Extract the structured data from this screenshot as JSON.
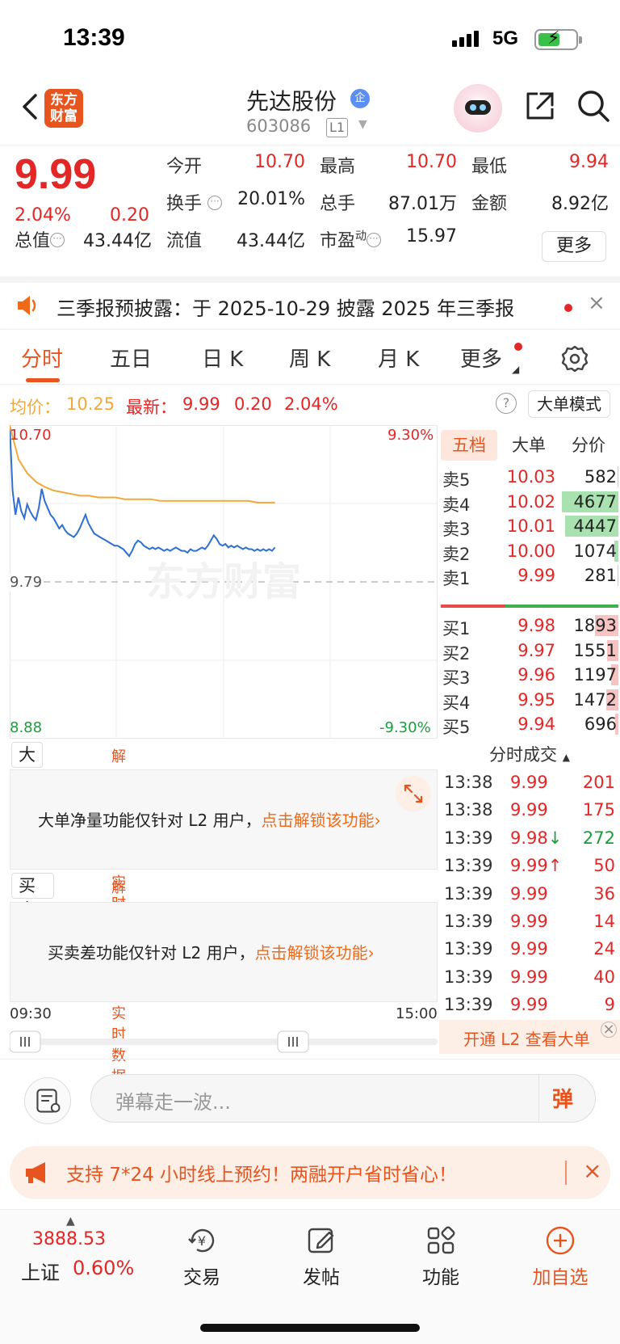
{
  "status_bar": {
    "time": "13:39",
    "network": "5G"
  },
  "header": {
    "logo_line1": "东方",
    "logo_line2": "财富",
    "stock_name": "先达股份",
    "badge": "企",
    "stock_code": "603086",
    "level": "L1"
  },
  "quote": {
    "price": "9.99",
    "change_pct": "2.04%",
    "change": "0.20",
    "open_label": "今开",
    "open": "10.70",
    "high_label": "最高",
    "high": "10.70",
    "low_label": "最低",
    "low": "9.94",
    "turnover_label": "换手",
    "turnover": "20.01%",
    "volume_label": "总手",
    "volume": "87.01万",
    "amount_label": "金额",
    "amount": "8.92亿",
    "total_cap_label": "总值",
    "total_cap": "43.44亿",
    "float_cap_label": "流值",
    "float_cap": "43.44亿",
    "pe_label": "市盈",
    "pe_sup": "动",
    "pe": "15.97",
    "more_label": "更多"
  },
  "notice": {
    "text": "三季报预披露：于 2025-10-29 披露 2025 年三季报",
    "close": "×"
  },
  "tabs": [
    "分时",
    "五日",
    "日 K",
    "周 K",
    "月 K",
    "更多"
  ],
  "info_line": {
    "avg_label": "均价：",
    "avg": "10.25",
    "latest_label": "最新：",
    "latest": "9.99",
    "change": "0.20",
    "change_pct": "2.04%",
    "help": "?",
    "mode_button": "大单模式"
  },
  "chart_data": {
    "type": "line",
    "title": "",
    "y_top": "10.70",
    "y_mid": "9.79",
    "y_bottom": "8.88",
    "pct_top": "9.30%",
    "pct_bottom": "-9.30%",
    "ylim": [
      8.88,
      10.7
    ],
    "prev_close": 9.79,
    "watermark": "东方财富",
    "series": [
      {
        "name": "price",
        "color": "#2e6fd1",
        "values": [
          10.7,
          10.32,
          10.18,
          10.28,
          10.2,
          10.16,
          10.24,
          10.2,
          10.17,
          10.15,
          10.22,
          10.33,
          10.26,
          10.22,
          10.18,
          10.16,
          10.13,
          10.1,
          10.12,
          10.09,
          10.07,
          10.06,
          10.05,
          10.07,
          10.1,
          10.14,
          10.18,
          10.13,
          10.1,
          10.07,
          10.06,
          10.05,
          10.04,
          10.03,
          10.02,
          10.01,
          10.0,
          10.0,
          9.99,
          9.98,
          9.96,
          9.94,
          9.97,
          10.01,
          10.03,
          10.02,
          10.0,
          9.99,
          9.98,
          9.99,
          9.98,
          9.99,
          9.98,
          9.97,
          9.98,
          9.97,
          9.98,
          9.99,
          9.98,
          9.97,
          9.97,
          9.96,
          9.98,
          9.97,
          9.97,
          9.98,
          9.99,
          9.98,
          10.0,
          10.03,
          10.06,
          10.04,
          10.01,
          10.0,
          10.01,
          9.99,
          10.0,
          9.99,
          10.0,
          9.99,
          9.98,
          9.99,
          9.98,
          9.98,
          9.97,
          9.98,
          9.97,
          9.98,
          9.97,
          9.98,
          9.97,
          9.99
        ]
      },
      {
        "name": "avg",
        "color": "#f2a93b",
        "values": [
          10.7,
          10.5,
          10.42,
          10.37,
          10.34,
          10.32,
          10.31,
          10.3,
          10.29,
          10.29,
          10.28,
          10.28,
          10.28,
          10.27,
          10.27,
          10.27,
          10.27,
          10.26,
          10.26,
          10.26,
          10.26,
          10.26,
          10.26,
          10.26,
          10.26,
          10.26,
          10.26,
          10.26,
          10.25,
          10.25,
          10.25
        ]
      }
    ],
    "total_points": 242
  },
  "order_book": {
    "tabs": [
      "五档",
      "大单",
      "分价"
    ],
    "asks": [
      {
        "label": "卖5",
        "price": "10.03",
        "vol": "582",
        "ratio": 0.02
      },
      {
        "label": "卖4",
        "price": "10.02",
        "vol": "4677",
        "ratio": 0.97
      },
      {
        "label": "卖3",
        "price": "10.01",
        "vol": "4447",
        "ratio": 0.92
      },
      {
        "label": "卖2",
        "price": "10.00",
        "vol": "1074",
        "ratio": 0.07
      },
      {
        "label": "卖1",
        "price": "9.99",
        "vol": "281",
        "ratio": 0.02
      }
    ],
    "bids": [
      {
        "label": "买1",
        "price": "9.98",
        "vol": "1893",
        "ratio": 0.4
      },
      {
        "label": "买2",
        "price": "9.97",
        "vol": "1551",
        "ratio": 0.2
      },
      {
        "label": "买3",
        "price": "9.96",
        "vol": "1197",
        "ratio": 0.12
      },
      {
        "label": "买4",
        "price": "9.95",
        "vol": "1472",
        "ratio": 0.21
      },
      {
        "label": "买5",
        "price": "9.94",
        "vol": "696",
        "ratio": 0.05
      }
    ]
  },
  "ticks": {
    "title": "分时成交",
    "rows": [
      {
        "time": "13:38",
        "price": "9.99",
        "vol": "201",
        "dir": "",
        "vcolor": "red"
      },
      {
        "time": "13:38",
        "price": "9.99",
        "vol": "175",
        "dir": "",
        "vcolor": "red"
      },
      {
        "time": "13:39",
        "price": "9.98",
        "vol": "272",
        "dir": "↓",
        "vcolor": "green"
      },
      {
        "time": "13:39",
        "price": "9.99",
        "vol": "50",
        "dir": "↑",
        "vcolor": "red"
      },
      {
        "time": "13:39",
        "price": "9.99",
        "vol": "36",
        "dir": "",
        "vcolor": "red"
      },
      {
        "time": "13:39",
        "price": "9.99",
        "vol": "14",
        "dir": "",
        "vcolor": "red"
      },
      {
        "time": "13:39",
        "price": "9.99",
        "vol": "24",
        "dir": "",
        "vcolor": "red"
      },
      {
        "time": "13:39",
        "price": "9.99",
        "vol": "40",
        "dir": "",
        "vcolor": "red"
      },
      {
        "time": "13:39",
        "price": "9.99",
        "vol": "9",
        "dir": "",
        "vcolor": "red"
      }
    ],
    "l2_text": "开通 L2 查看大单"
  },
  "indicators": {
    "panel1_select": "大单净量",
    "panel1_link": "解锁查看最新实时数据",
    "panel1_text": "大单净量功能仅针对 L2 用户，",
    "panel1_cta": "点击解锁该功能",
    "panel2_select": "买卖差",
    "panel2_link": "解锁查看最新实时数据",
    "panel2_text": "买卖差功能仅针对 L2 用户，",
    "panel2_cta": "点击解锁该功能"
  },
  "time_axis": {
    "start": "09:30",
    "end": "15:00"
  },
  "comment": {
    "placeholder": "弹幕走一波...",
    "danmu": "弹"
  },
  "promo": {
    "text": "支持 7*24 小时线上预约！两融开户省时省心！",
    "close": "×"
  },
  "bottom_nav": {
    "index_value": "3888.53",
    "index_label": "上证",
    "index_pct": "0.60%",
    "items": [
      {
        "label": "交易"
      },
      {
        "label": "发帖"
      },
      {
        "label": "功能"
      },
      {
        "label": "加自选"
      }
    ]
  }
}
